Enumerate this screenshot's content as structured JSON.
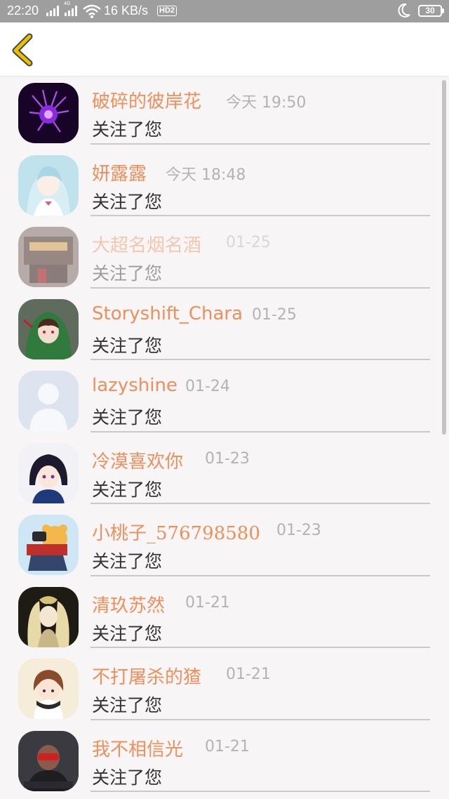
{
  "status_bar": {
    "time": "22:20",
    "network_speed": "16 KB/s",
    "hd_label": "HD2",
    "battery": "30",
    "signal_tag": "4G",
    "icons": [
      "signal-icon",
      "signal-icon",
      "wifi-icon",
      "moon-icon",
      "battery-icon"
    ]
  },
  "header": {
    "back_icon": "chevron-left-icon"
  },
  "colors": {
    "accent": "#ef8f5b",
    "timestamp": "#b3b3b3",
    "back_icon": "#e8c200"
  },
  "notifications": [
    {
      "name": "破碎的彼岸花",
      "time": "今天 19:50",
      "action": "关注了您"
    },
    {
      "name": "妍露露",
      "time": "今天 18:48",
      "action": "关注了您"
    },
    {
      "name": "大超名烟名酒",
      "time": "01-25",
      "action": "关注了您"
    },
    {
      "name": "Storyshift_Chara",
      "time": "01-25",
      "action": "关注了您"
    },
    {
      "name": "lazyshine",
      "time": "01-24",
      "action": "关注了您"
    },
    {
      "name": "冷漠喜欢你",
      "time": "01-23",
      "action": "关注了您"
    },
    {
      "name": "小桃子_576798580",
      "time": "01-23",
      "action": "关注了您"
    },
    {
      "name": "清玖苏然",
      "time": "01-21",
      "action": "关注了您"
    },
    {
      "name": "不打屠杀的猹",
      "time": "01-21",
      "action": "关注了您"
    },
    {
      "name": "我不相信光",
      "time": "01-21",
      "action": "关注了您"
    }
  ]
}
